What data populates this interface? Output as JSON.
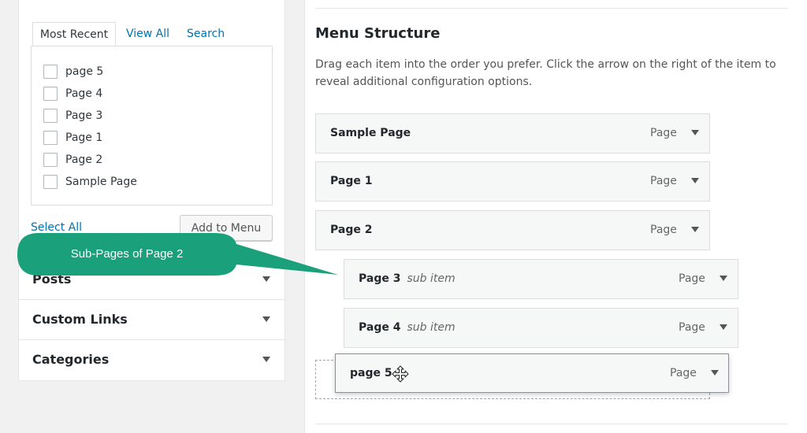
{
  "left_panel": {
    "tabs": [
      {
        "label": "Most Recent"
      },
      {
        "label": "View All"
      },
      {
        "label": "Search"
      }
    ],
    "pages": [
      {
        "label": "page 5"
      },
      {
        "label": "Page 4"
      },
      {
        "label": "Page 3"
      },
      {
        "label": "Page 1"
      },
      {
        "label": "Page 2"
      },
      {
        "label": "Sample Page"
      }
    ],
    "select_all": "Select All",
    "add_to_menu": "Add to Menu",
    "accordions": [
      {
        "label": "Posts"
      },
      {
        "label": "Custom Links"
      },
      {
        "label": "Categories"
      }
    ]
  },
  "menu_structure": {
    "title": "Menu Structure",
    "description": "Drag each item into the order you prefer. Click the arrow on the right of the item to reveal additional configuration options.",
    "items": [
      {
        "title": "Sample Page",
        "sub": "",
        "type": "Page"
      },
      {
        "title": "Page 1",
        "sub": "",
        "type": "Page"
      },
      {
        "title": "Page 2",
        "sub": "",
        "type": "Page"
      },
      {
        "title": "Page 3",
        "sub": "sub item",
        "type": "Page"
      },
      {
        "title": "Page 4",
        "sub": "sub item",
        "type": "Page"
      }
    ],
    "dragging_item": {
      "title": "page 5",
      "type": "Page"
    }
  },
  "callout": {
    "text": "Sub-Pages of Page 2",
    "color": "#1aa07a"
  }
}
